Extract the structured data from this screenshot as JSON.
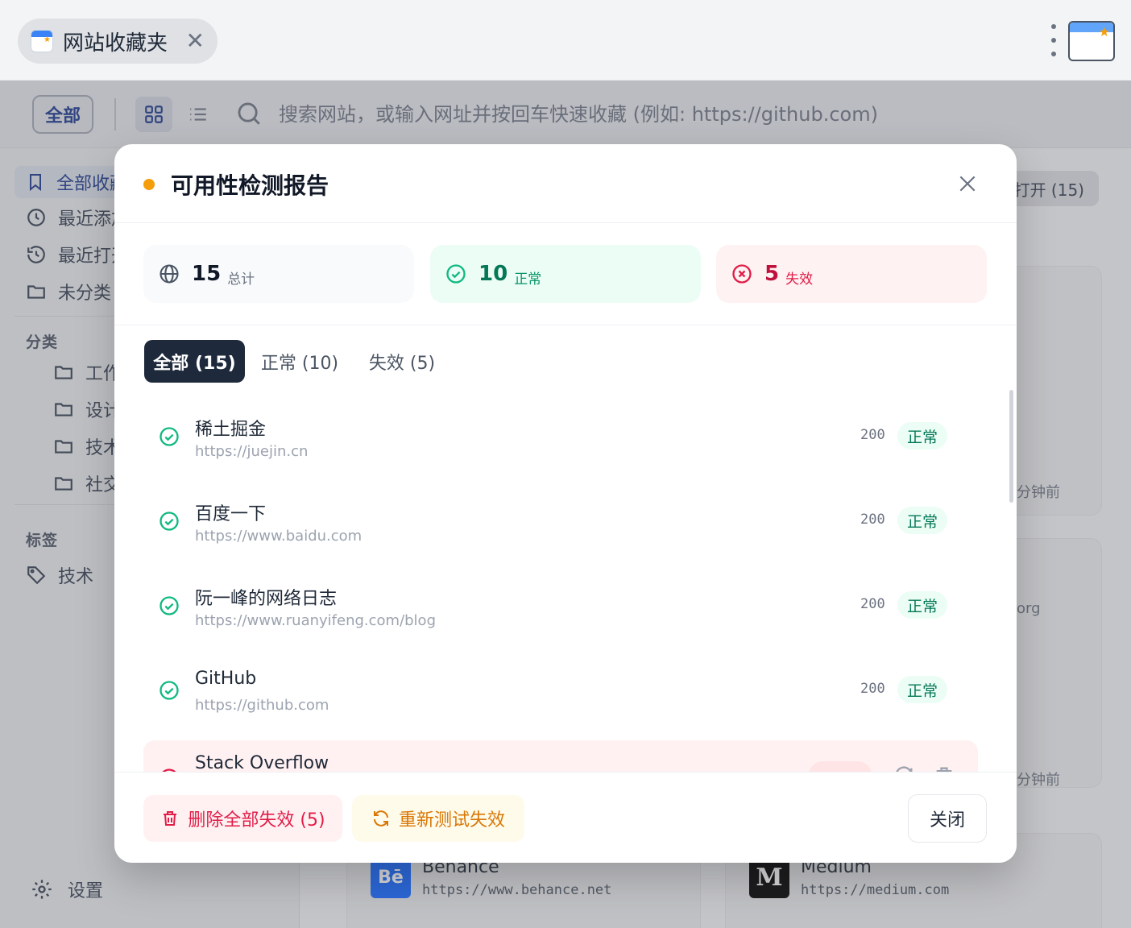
{
  "browser": {
    "tab_title": "网站收藏夹",
    "tab_close": "✕"
  },
  "toolbar": {
    "all_label": "全部",
    "search_placeholder": "搜索网站，或输入网址并按回车快速收藏 (例如: https://github.com)"
  },
  "sidebar": {
    "items": [
      {
        "label": "全部收藏"
      },
      {
        "label": "最近添加"
      },
      {
        "label": "最近打开"
      },
      {
        "label": "未分类"
      }
    ],
    "categories_heading": "分类",
    "categories": [
      {
        "label": "工作"
      },
      {
        "label": "设计"
      },
      {
        "label": "技术"
      },
      {
        "label": "社交"
      }
    ],
    "tags_heading": "标签",
    "tags": [
      {
        "label": "技术"
      }
    ],
    "settings_label": "设置"
  },
  "main": {
    "open_button": "打开 (15)",
    "meta_1": "分钟前",
    "meta_2": "org",
    "meta_3": "分钟前",
    "sites": [
      {
        "name": "Behance",
        "url": "https://www.behance.net",
        "logo": "Bē"
      },
      {
        "name": "Medium",
        "url": "https://medium.com",
        "logo": "M"
      }
    ]
  },
  "modal": {
    "title": "可用性检测报告",
    "stats": {
      "total": {
        "value": "15",
        "label": "总计"
      },
      "ok": {
        "value": "10",
        "label": "正常"
      },
      "bad": {
        "value": "5",
        "label": "失效"
      }
    },
    "filters": [
      {
        "label": "全部 (15)"
      },
      {
        "label": "正常 (10)"
      },
      {
        "label": "失效 (5)"
      }
    ],
    "rows": [
      {
        "name": "稀土掘金",
        "url": "https://juejin.cn",
        "code": "200",
        "status": "正常"
      },
      {
        "name": "百度一下",
        "url": "https://www.baidu.com",
        "code": "200",
        "status": "正常"
      },
      {
        "name": "阮一峰的网络日志",
        "url": "https://www.ruanyifeng.com/blog",
        "code": "200",
        "status": "正常"
      },
      {
        "name": "GitHub",
        "url": "https://github.com",
        "code": "200",
        "status": "正常"
      },
      {
        "name": "Stack Overflow",
        "url": "",
        "code": "",
        "status": ""
      }
    ],
    "footer": {
      "delete_label": "删除全部失效 (5)",
      "retest_label": "重新测试失效",
      "close_label": "关闭"
    }
  },
  "colors": {
    "accent_dark": "#1e293b",
    "ok": "#10b981",
    "bad": "#e11d48",
    "warn": "#f59e0b"
  }
}
